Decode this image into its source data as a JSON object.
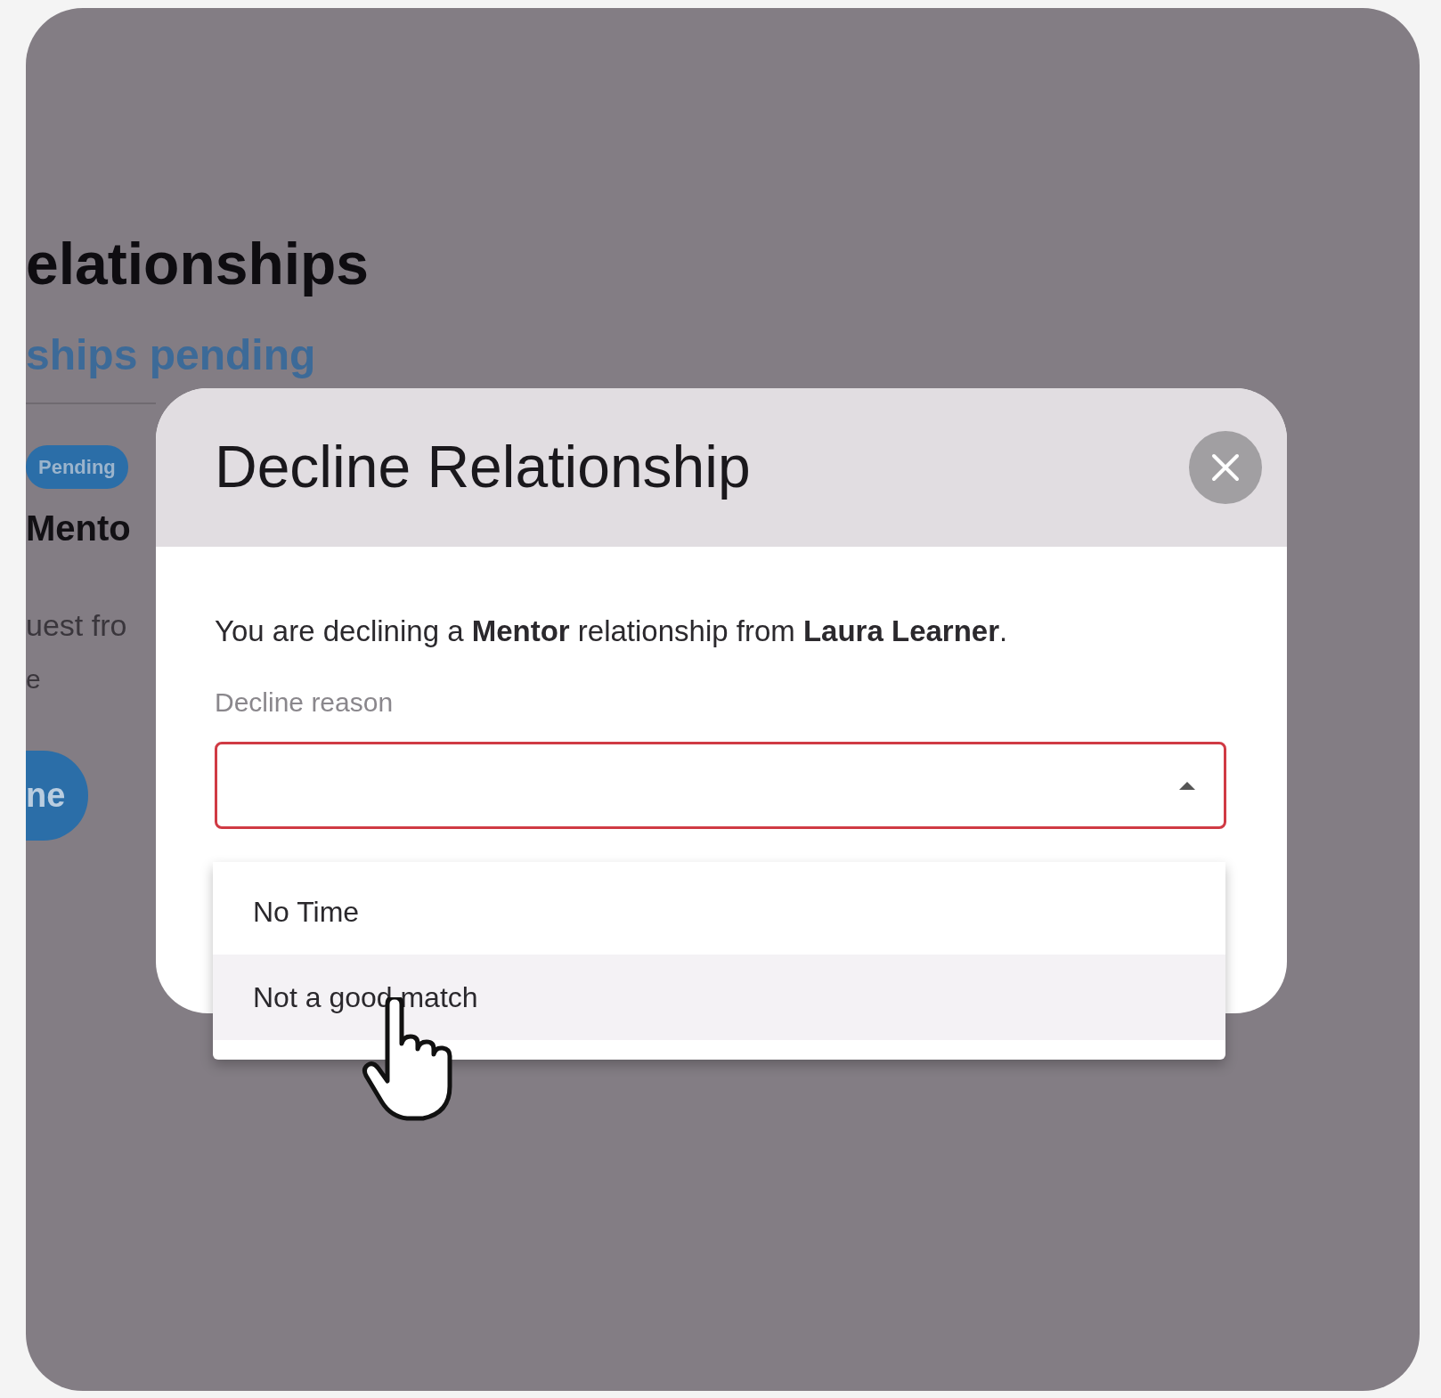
{
  "background": {
    "heading": "elationships",
    "subheading": "ships pending",
    "badge": "Pending",
    "role": "Mento",
    "request_text": "uest fro",
    "line_2": "e",
    "button": "ne"
  },
  "modal": {
    "title": "Decline Relationship",
    "message": "You are declining a **Mentor** relationship from **Laura Learner**.",
    "field": {
      "label": "Decline reason",
      "invalid": true,
      "expanded": true
    },
    "options": [
      {
        "label": "No Time",
        "selected": false
      },
      {
        "label": "Not a good match",
        "selected": true
      }
    ]
  }
}
